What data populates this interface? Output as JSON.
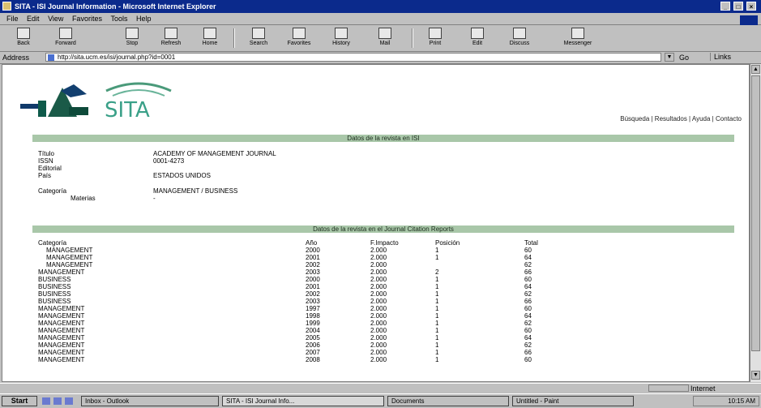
{
  "window": {
    "title": "SITA - ISI Journal Information - Microsoft Internet Explorer",
    "controls": [
      "_",
      "□",
      "×"
    ]
  },
  "menu": [
    "File",
    "Edit",
    "View",
    "Favorites",
    "Tools",
    "Help"
  ],
  "toolbar": [
    {
      "label": "Back",
      "icon": "back-arrow-icon"
    },
    {
      "label": "Forward",
      "icon": "forward-arrow-icon"
    },
    {
      "label": "Stop",
      "icon": "stop-icon"
    },
    {
      "label": "Refresh",
      "icon": "refresh-icon"
    },
    {
      "label": "Home",
      "icon": "home-icon"
    },
    {
      "label": "Search",
      "icon": "search-icon"
    },
    {
      "label": "Favorites",
      "icon": "favorites-icon"
    },
    {
      "label": "History",
      "icon": "history-icon"
    },
    {
      "label": "Mail",
      "icon": "mail-icon"
    },
    {
      "label": "Print",
      "icon": "print-icon"
    },
    {
      "label": "Edit",
      "icon": "edit-icon"
    },
    {
      "label": "Discuss",
      "icon": "discuss-icon"
    },
    {
      "label": "Messenger",
      "icon": "messenger-icon"
    }
  ],
  "address": {
    "label": "Address",
    "url": "http://sita.ucm.es/isi/journal.php?id=0001",
    "go": "Go",
    "links": "Links"
  },
  "page": {
    "top_links": "Búsqueda | Resultados | Ayuda | Contacto",
    "section1_title": "Datos de la revista en ISI",
    "fields": [
      {
        "key": "Título",
        "value": "ACADEMY OF MANAGEMENT JOURNAL"
      },
      {
        "key": "ISSN",
        "value": "0001-4273"
      },
      {
        "key": "Editorial",
        "value": ""
      },
      {
        "key": "País",
        "value": "ESTADOS UNIDOS"
      },
      {
        "key": "Categoría",
        "value": "MANAGEMENT / BUSINESS"
      },
      {
        "key": "Materias",
        "value": "-"
      }
    ],
    "section2_title": "Datos de la revista en el Journal Citation Reports",
    "table_headers": [
      "Categoría",
      "Año",
      "F.Impacto",
      "Posición",
      "Total"
    ],
    "table_rows": [
      [
        "MANAGEMENT",
        "2000",
        "2.000",
        "1",
        "60"
      ],
      [
        "MANAGEMENT",
        "2001",
        "2.000",
        "1",
        "64"
      ],
      [
        "MANAGEMENT",
        "2002",
        "2.000",
        "",
        "62"
      ],
      [
        "MANAGEMENT",
        "2003",
        "2.000",
        "2",
        "66"
      ],
      [
        "BUSINESS",
        "2000",
        "2.000",
        "1",
        "60"
      ],
      [
        "BUSINESS",
        "2001",
        "2.000",
        "1",
        "64"
      ],
      [
        "BUSINESS",
        "2002",
        "2.000",
        "1",
        "62"
      ],
      [
        "BUSINESS",
        "2003",
        "2.000",
        "1",
        "66"
      ],
      [
        "MANAGEMENT",
        "1997",
        "2.000",
        "1",
        "60"
      ],
      [
        "MANAGEMENT",
        "1998",
        "2.000",
        "1",
        "64"
      ],
      [
        "MANAGEMENT",
        "1999",
        "2.000",
        "1",
        "62"
      ],
      [
        "MANAGEMENT",
        "2004",
        "2.000",
        "1",
        "60"
      ],
      [
        "MANAGEMENT",
        "2005",
        "2.000",
        "1",
        "64"
      ],
      [
        "MANAGEMENT",
        "2006",
        "2.000",
        "1",
        "62"
      ],
      [
        "MANAGEMENT",
        "2007",
        "2.000",
        "1",
        "66"
      ],
      [
        "MANAGEMENT",
        "2008",
        "2.000",
        "1",
        "60"
      ]
    ]
  },
  "status": {
    "zone": "Internet"
  },
  "taskbar": {
    "start": "Start",
    "tasks": [
      "Inbox - Outlook",
      "SITA - ISI Journal Info...",
      "Documents",
      "Untitled - Paint"
    ],
    "clock": "10:15 AM"
  }
}
